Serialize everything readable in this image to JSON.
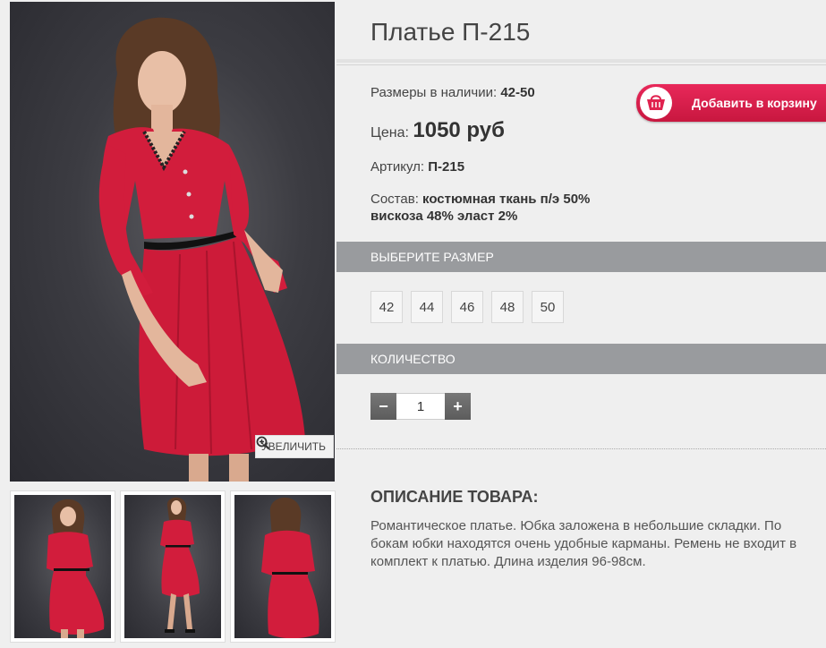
{
  "product": {
    "title": "Платье П-215",
    "sizes_label": "Размеры в наличии:",
    "sizes_value": "42-50",
    "price_label": "Цена:",
    "price_value": "1050 руб",
    "sku_label": "Артикул:",
    "sku_value": "П-215",
    "composition_label": "Состав:",
    "composition_line1": "костюмная ткань п/э 50%",
    "composition_line2": "вискоза 48% эласт 2%"
  },
  "cart": {
    "label": "Добавить в корзину",
    "icon": "basket-icon"
  },
  "gallery": {
    "zoom_label": "УВЕЛИЧИТЬ",
    "zoom_icon": "magnifier-plus-icon",
    "thumbnail_count": 3
  },
  "size_section": {
    "heading": "ВЫБЕРИТЕ РАЗМЕР",
    "options": [
      "42",
      "44",
      "46",
      "48",
      "50"
    ]
  },
  "quantity_section": {
    "heading": "КОЛИЧЕСТВО",
    "minus": "−",
    "plus": "+",
    "value": "1"
  },
  "description": {
    "heading": "ОПИСАНИЕ ТОВАРА:",
    "text": "Романтическое платье. Юбка заложена в небольшие складки. По бокам юбки находятся очень удобные карманы. Ремень не входит в комплект к платью. Длина изделия 96-98см."
  },
  "colors": {
    "accent": "#e0224f",
    "bar": "#999b9e",
    "dress": "#d21d3c",
    "background": "#efefef"
  }
}
